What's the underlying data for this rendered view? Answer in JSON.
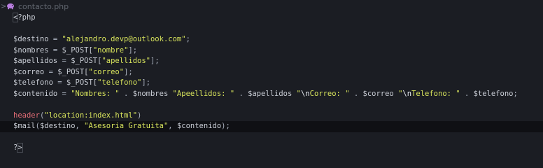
{
  "editor": {
    "breadcrumb": {
      "chevron": ">",
      "file_icon": "php-elephant-icon",
      "filename": "contacto.php"
    },
    "lines": [
      [
        {
          "t": "<",
          "c": "bracket"
        },
        {
          "t": "?php",
          "c": "tag"
        }
      ],
      [],
      [
        {
          "t": "$destino",
          "c": "var"
        },
        {
          "t": " = ",
          "c": "punc"
        },
        {
          "t": "\"alejandro.devp@outlook.com\"",
          "c": "str"
        },
        {
          "t": ";",
          "c": "punc"
        }
      ],
      [
        {
          "t": "$nombres",
          "c": "var"
        },
        {
          "t": " = ",
          "c": "punc"
        },
        {
          "t": "$_POST[",
          "c": "var"
        },
        {
          "t": "\"nombre\"",
          "c": "str"
        },
        {
          "t": "];",
          "c": "punc"
        }
      ],
      [
        {
          "t": "$apellidos",
          "c": "var"
        },
        {
          "t": " = ",
          "c": "punc"
        },
        {
          "t": "$_POST[",
          "c": "var"
        },
        {
          "t": "\"apellidos\"",
          "c": "str"
        },
        {
          "t": "];",
          "c": "punc"
        }
      ],
      [
        {
          "t": "$correo",
          "c": "var"
        },
        {
          "t": " = ",
          "c": "punc"
        },
        {
          "t": "$_POST[",
          "c": "var"
        },
        {
          "t": "\"correo\"",
          "c": "str"
        },
        {
          "t": "];",
          "c": "punc"
        }
      ],
      [
        {
          "t": "$telefono",
          "c": "var"
        },
        {
          "t": " = ",
          "c": "punc"
        },
        {
          "t": "$_POST[",
          "c": "var"
        },
        {
          "t": "\"telefono\"",
          "c": "str"
        },
        {
          "t": "];",
          "c": "punc"
        }
      ],
      [
        {
          "t": "$contenido",
          "c": "var"
        },
        {
          "t": " = ",
          "c": "punc"
        },
        {
          "t": "\"Nombres: \"",
          "c": "str"
        },
        {
          "t": " . ",
          "c": "punc"
        },
        {
          "t": "$nombres",
          "c": "var"
        },
        {
          "t": " ",
          "c": "punc"
        },
        {
          "t": "\"Apeellidos: \"",
          "c": "str"
        },
        {
          "t": " . ",
          "c": "punc"
        },
        {
          "t": "$apellidos",
          "c": "var"
        },
        {
          "t": " ",
          "c": "punc"
        },
        {
          "t": "\"",
          "c": "str"
        },
        {
          "t": "\\n",
          "c": "esc"
        },
        {
          "t": "Correo: \"",
          "c": "str"
        },
        {
          "t": " . ",
          "c": "punc"
        },
        {
          "t": "$correo",
          "c": "var"
        },
        {
          "t": " ",
          "c": "punc"
        },
        {
          "t": "\"",
          "c": "str"
        },
        {
          "t": "\\n",
          "c": "esc"
        },
        {
          "t": "Telefono: \"",
          "c": "str"
        },
        {
          "t": " . ",
          "c": "punc"
        },
        {
          "t": "$telefono",
          "c": "var"
        },
        {
          "t": ";",
          "c": "punc"
        }
      ],
      [],
      [
        {
          "t": "header",
          "c": "func"
        },
        {
          "t": "(",
          "c": "punc"
        },
        {
          "t": "\"location:index.html\"",
          "c": "str"
        },
        {
          "t": ")",
          "c": "punc"
        }
      ],
      [
        {
          "t": "$mail",
          "c": "var"
        },
        {
          "t": "(",
          "c": "punc"
        },
        {
          "t": "$destino",
          "c": "var"
        },
        {
          "t": ", ",
          "c": "punc"
        },
        {
          "t": "\"Asesoria Gratuita\"",
          "c": "str"
        },
        {
          "t": ", ",
          "c": "punc"
        },
        {
          "t": "$contenido",
          "c": "var"
        },
        {
          "t": ");",
          "c": "punc"
        }
      ],
      [],
      [
        {
          "t": "?",
          "c": "tag"
        },
        {
          "t": ">",
          "c": "bracket"
        }
      ]
    ],
    "active_line": 10
  },
  "colors": {
    "background": "#1b1d23",
    "active_line": "#0f1014",
    "string": "#d7e35c",
    "function": "#e06c75",
    "variable": "#c8ccd4",
    "icon": "#b97ee0"
  }
}
